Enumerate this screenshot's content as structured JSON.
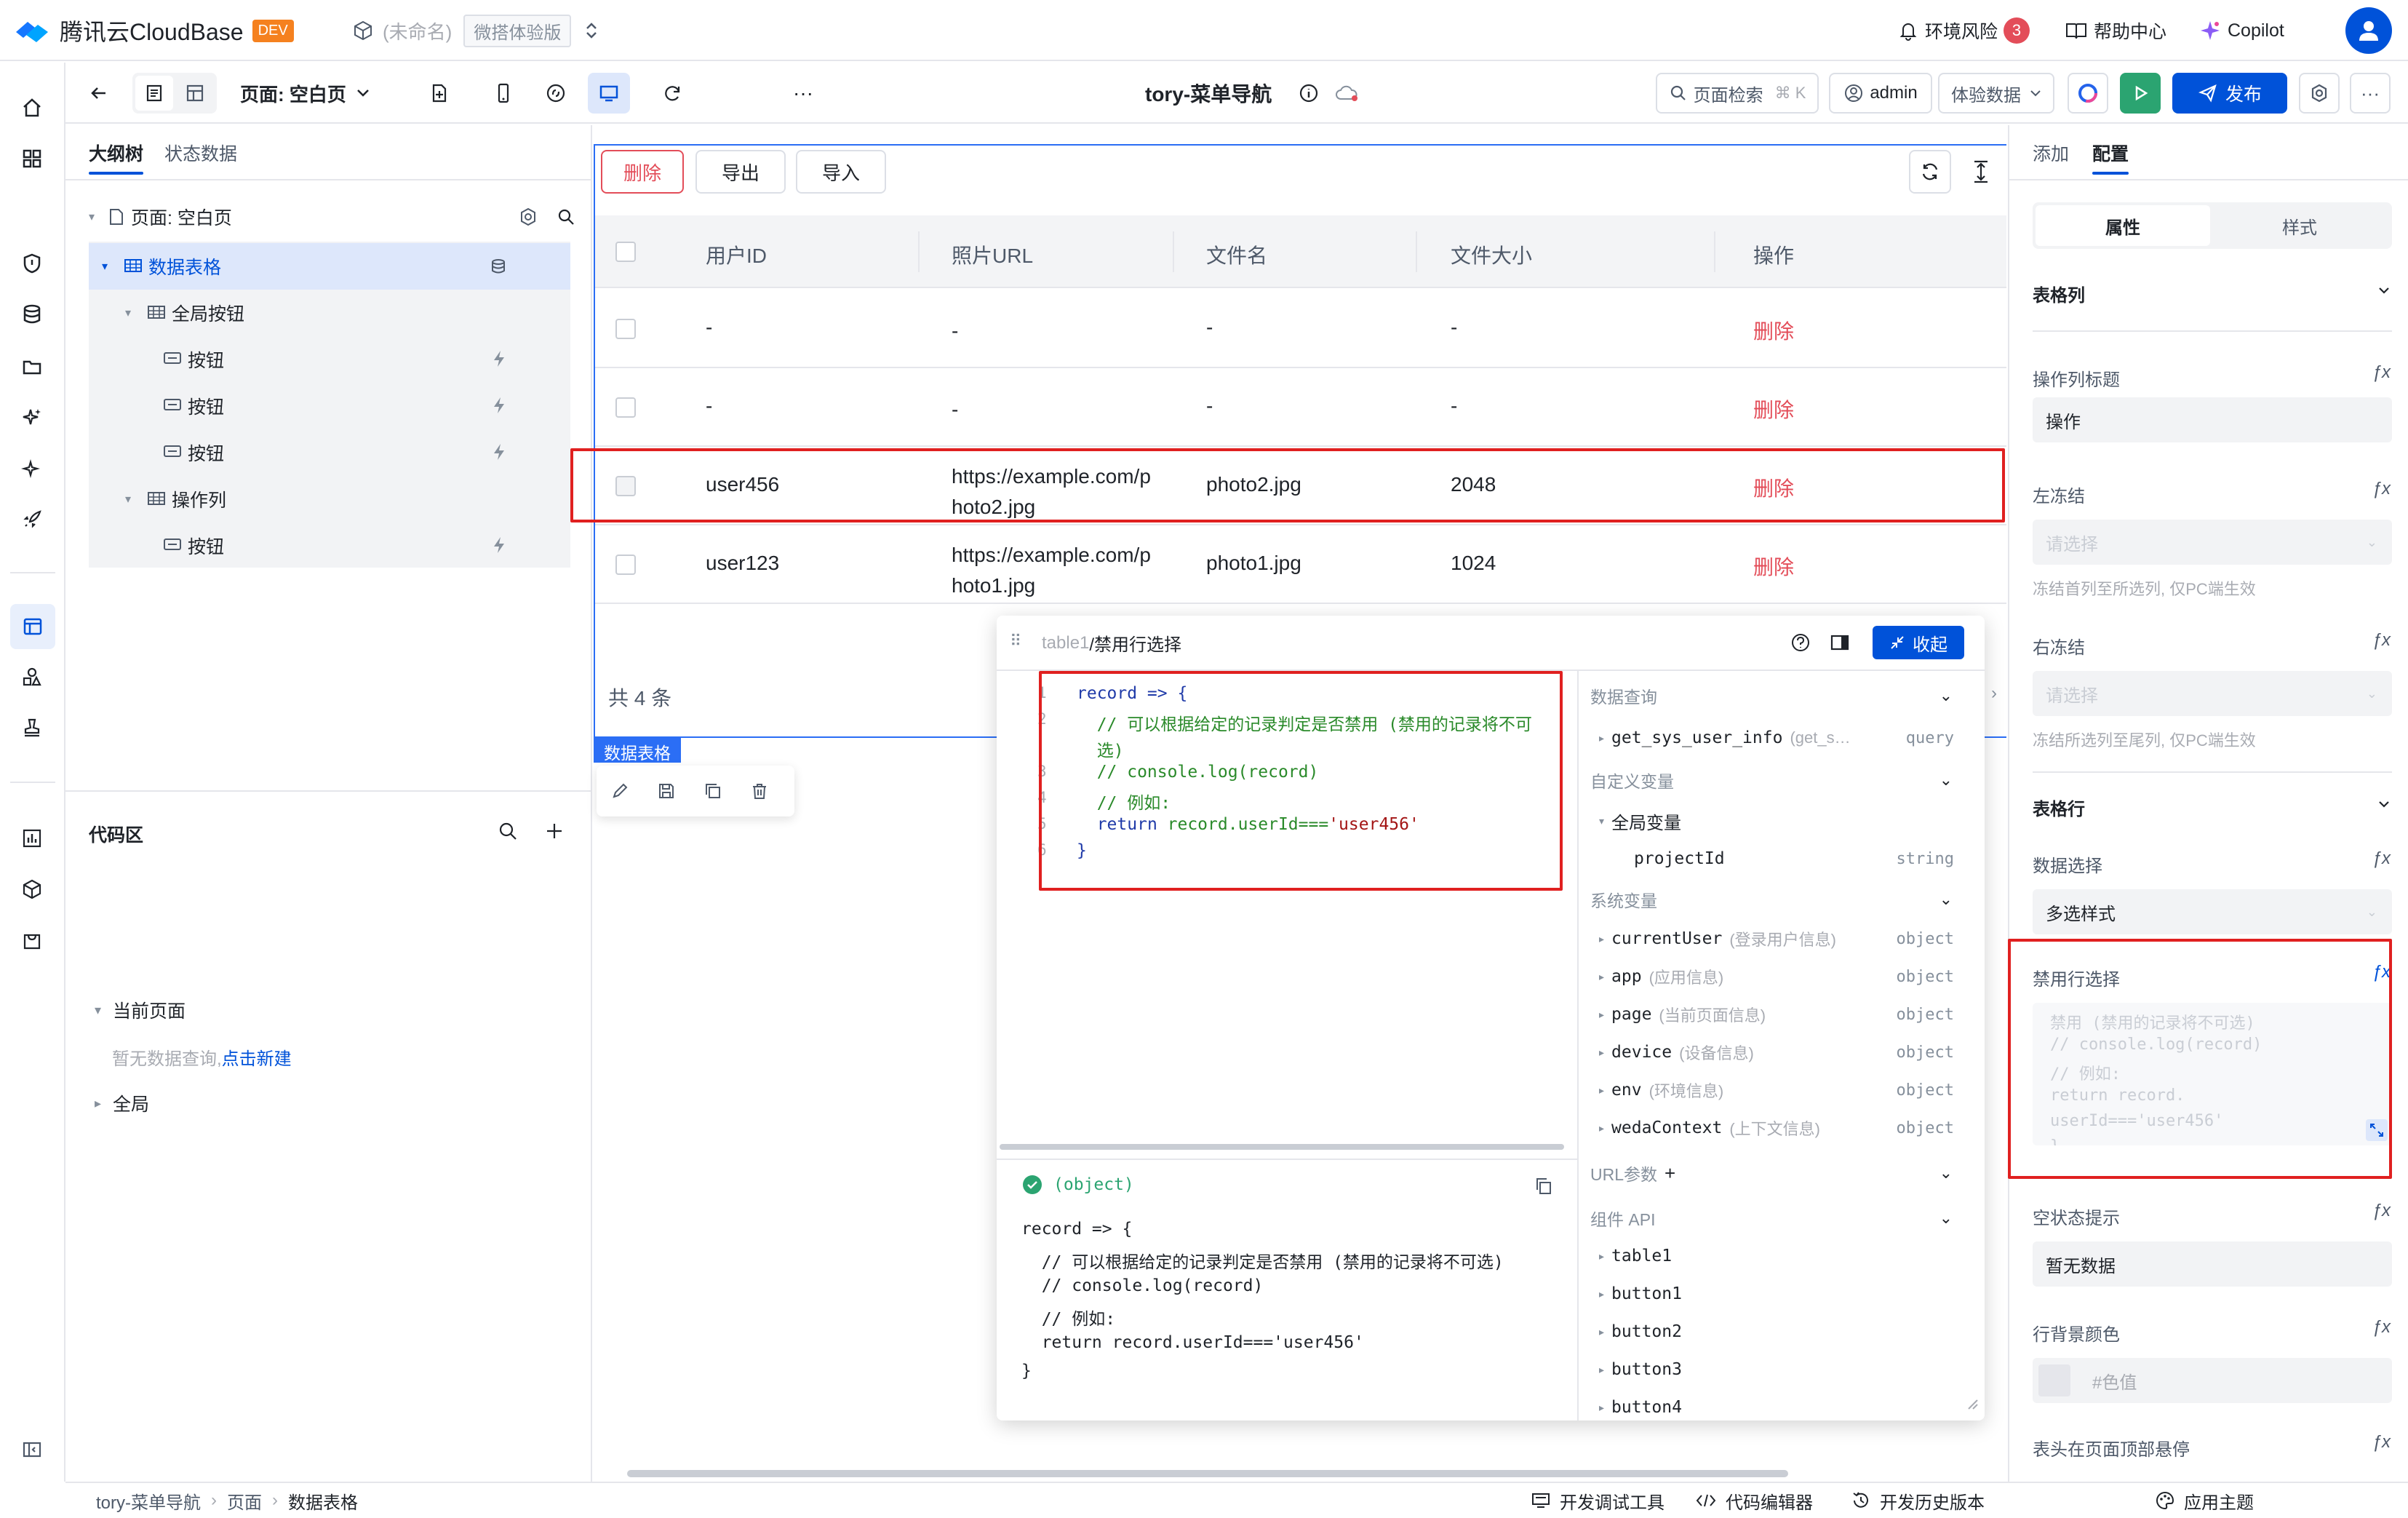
{
  "topbar": {
    "brand": "腾讯云CloudBase",
    "env_badge": "DEV",
    "app_name": "(未命名)",
    "edition": "微搭体验版",
    "env_risk": "环境风险",
    "env_risk_count": "3",
    "help": "帮助中心",
    "copilot": "Copilot"
  },
  "toolbar": {
    "page_label": "页面: 空白页",
    "app_title": "tory-菜单导航",
    "search_label": "页面检索",
    "search_shortcut": "⌘ K",
    "user": "admin",
    "data_mode": "体验数据",
    "publish": "发布"
  },
  "outline": {
    "tabs": [
      "大纲树",
      "状态数据"
    ],
    "root": "页面: 空白页",
    "nodes": [
      {
        "label": "数据表格",
        "level": 1,
        "selected": true,
        "icon": "table-icon"
      },
      {
        "label": "全局按钮",
        "level": 2,
        "selected": false,
        "icon": "table-icon"
      },
      {
        "label": "按钮",
        "level": 3,
        "selected": false,
        "icon": "button-icon"
      },
      {
        "label": "按钮",
        "level": 3,
        "selected": false,
        "icon": "button-icon"
      },
      {
        "label": "按钮",
        "level": 3,
        "selected": false,
        "icon": "button-icon"
      },
      {
        "label": "操作列",
        "level": 2,
        "selected": false,
        "icon": "table-icon"
      },
      {
        "label": "按钮",
        "level": 3,
        "selected": false,
        "icon": "button-icon"
      }
    ],
    "code_area": "代码区",
    "current_page": "当前页面",
    "no_query": "暂无数据查询,",
    "new_link": "点击新建",
    "global": "全局"
  },
  "canvas": {
    "buttons": [
      "删除",
      "导出",
      "导入"
    ],
    "columns": [
      "用户ID",
      "照片URL",
      "文件名",
      "文件大小",
      "操作"
    ],
    "rows": [
      {
        "id": "-",
        "url1": "-",
        "url2": "",
        "name": "-",
        "size": "-",
        "action": "删除"
      },
      {
        "id": "-",
        "url1": "-",
        "url2": "",
        "name": "-",
        "size": "-",
        "action": "删除"
      },
      {
        "id": "user456",
        "url1": "https://example.com/p",
        "url2": "hoto2.jpg",
        "name": "photo2.jpg",
        "size": "2048",
        "action": "删除"
      },
      {
        "id": "user123",
        "url1": "https://example.com/p",
        "url2": "hoto1.jpg",
        "name": "photo1.jpg",
        "size": "1024",
        "action": "删除"
      }
    ],
    "total": "共 4 条",
    "selected_tag": "数据表格"
  },
  "editor": {
    "path_prefix": "table1",
    "path_title": "/禁用行选择",
    "collapse": "收起",
    "code_lines": [
      {
        "n": "1",
        "text": "record => {"
      },
      {
        "n": "2",
        "text": "  // 可以根据给定的记录判定是否禁用 (禁用的记录将不可"
      },
      {
        "n": "",
        "text": "  选)"
      },
      {
        "n": "3",
        "text": "  // console.log(record)"
      },
      {
        "n": "4",
        "text": "  // 例如:"
      },
      {
        "n": "5",
        "text": "  return record.userId==='user456'"
      },
      {
        "n": "6",
        "text": "}"
      }
    ],
    "result_type": "(object)",
    "result_lines": [
      "record => {",
      "  // 可以根据给定的记录判定是否禁用 (禁用的记录将不可选)",
      "  // console.log(record)",
      "  // 例如:",
      "  return record.userId==='user456'",
      "}"
    ],
    "sections": {
      "data_query": "数据查询",
      "custom_vars": "自定义变量",
      "global_vars": "全局变量",
      "system_vars": "系统变量",
      "url_params": "URL参数",
      "component_api": "组件 API"
    },
    "query_item": {
      "name": "get_sys_user_info",
      "desc": "(get_s…",
      "type": "query"
    },
    "global_var": {
      "name": "projectId",
      "type": "string"
    },
    "system_vars": [
      {
        "name": "currentUser",
        "desc": "(登录用户信息)",
        "type": "object"
      },
      {
        "name": "app",
        "desc": "(应用信息)",
        "type": "object"
      },
      {
        "name": "page",
        "desc": "(当前页面信息)",
        "type": "object"
      },
      {
        "name": "device",
        "desc": "(设备信息)",
        "type": "object"
      },
      {
        "name": "env",
        "desc": "(环境信息)",
        "type": "object"
      },
      {
        "name": "wedaContext",
        "desc": "(上下文信息)",
        "type": "object"
      }
    ],
    "components": [
      "table1",
      "button1",
      "button2",
      "button3",
      "button4"
    ]
  },
  "rightpanel": {
    "tabs": [
      "添加",
      "配置"
    ],
    "subtabs": [
      "属性",
      "样式"
    ],
    "table_col": "表格列",
    "op_col_title": "操作列标题",
    "op_col_value": "操作",
    "left_freeze": "左冻结",
    "select_placeholder": "请选择",
    "left_freeze_hint": "冻结首列至所选列, 仅PC端生效",
    "right_freeze": "右冻结",
    "right_freeze_hint": "冻结所选列至尾列, 仅PC端生效",
    "table_row": "表格行",
    "data_select": "数据选择",
    "data_select_value": "多选样式",
    "disable_select": "禁用行选择",
    "disable_code": [
      "禁用 (禁用的记录将不可选)",
      "// console.log(record)",
      "// 例如:",
      "return record.",
      "userId==='user456'",
      "}"
    ],
    "empty_hint": "空状态提示",
    "empty_value": "暂无数据",
    "row_bg": "行背景颜色",
    "color_placeholder": "#色值",
    "sticky_header": "表头在页面顶部悬停"
  },
  "statusbar": {
    "breadcrumb": [
      "tory-菜单导航",
      "页面",
      "数据表格"
    ],
    "devtools": "开发调试工具",
    "code_editor": "代码编辑器",
    "history": "开发历史版本",
    "theme": "应用主题"
  },
  "colors": {
    "primary": "#0052d9",
    "danger": "#e34d59",
    "highlight_red": "#e02020",
    "success": "#2ba471",
    "selected_bg": "#dde7fb"
  }
}
